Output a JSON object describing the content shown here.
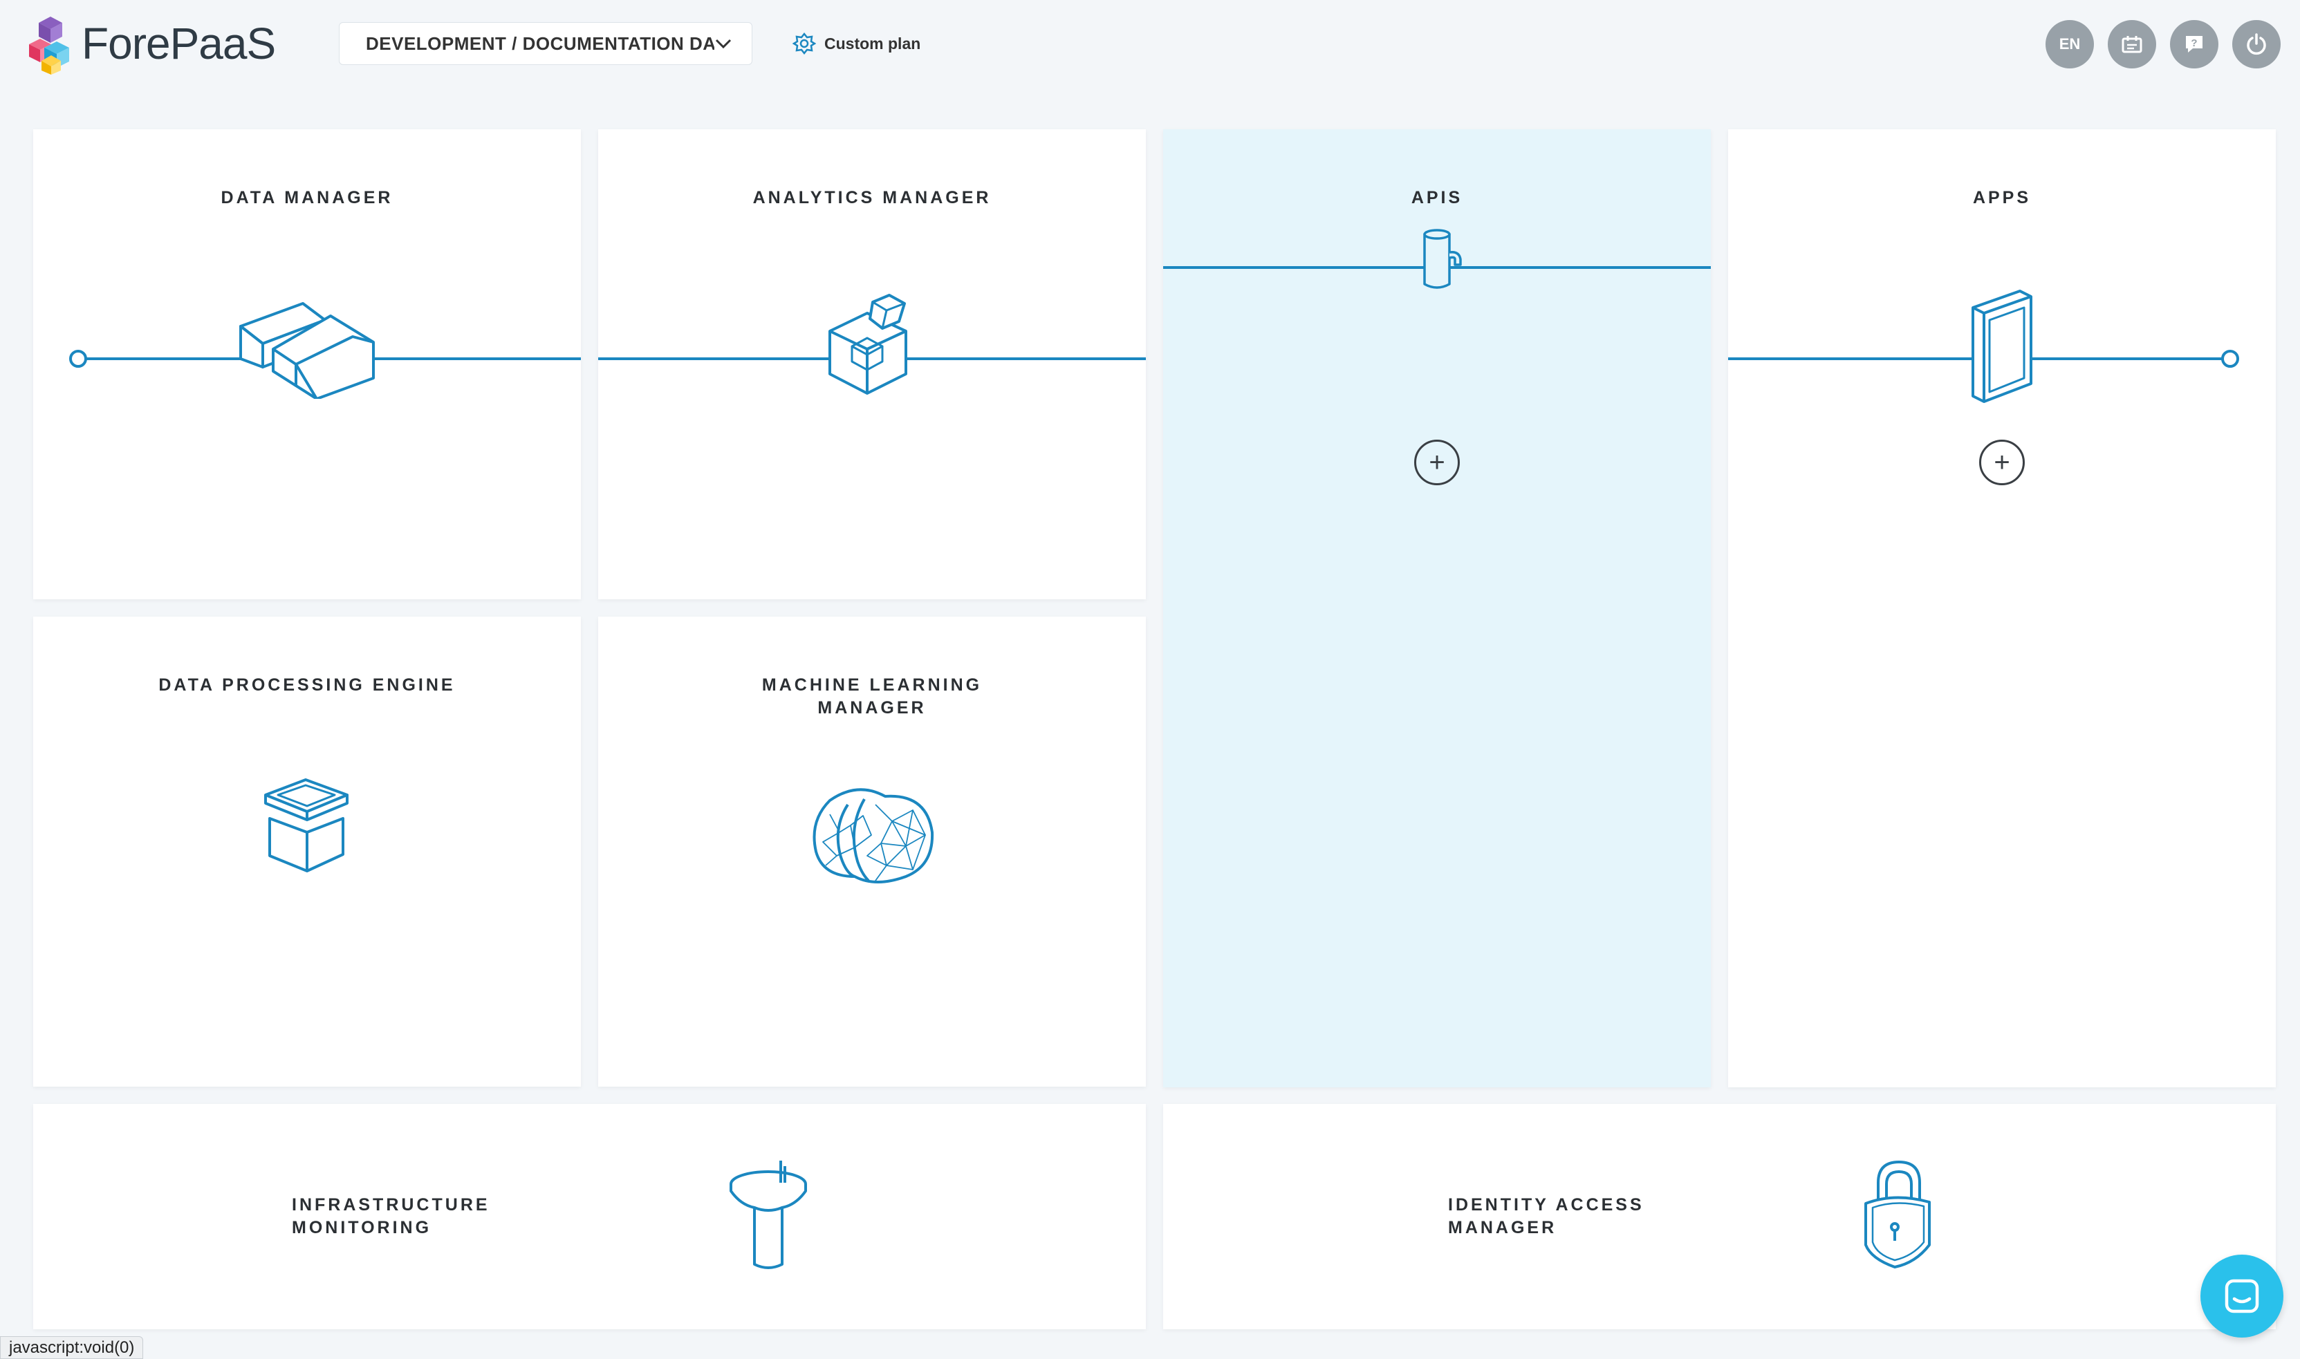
{
  "brand": {
    "name": "ForePaaS"
  },
  "header": {
    "project_selector": "DEVELOPMENT  /  DOCUMENTATION DA...",
    "plan_label": "Custom plan",
    "lang_button": "EN"
  },
  "cards": {
    "data_manager": "DATA MANAGER",
    "analytics_manager": "ANALYTICS MANAGER",
    "apis": "APIS",
    "apps": "APPS",
    "data_processing_engine": "DATA PROCESSING ENGINE",
    "ml_manager_line1": "MACHINE LEARNING",
    "ml_manager_line2": "MANAGER",
    "infra_line1": "INFRASTRUCTURE",
    "infra_line2": "MONITORING",
    "iam_line1": "IDENTITY ACCESS",
    "iam_line2": "MANAGER"
  },
  "status_bar": {
    "text": "javascript:void(0)"
  },
  "colors": {
    "accent": "#1b87c0",
    "active_card": "#e5f5fb",
    "chat": "#2ac1eb",
    "header_button": "#98a1a8"
  }
}
